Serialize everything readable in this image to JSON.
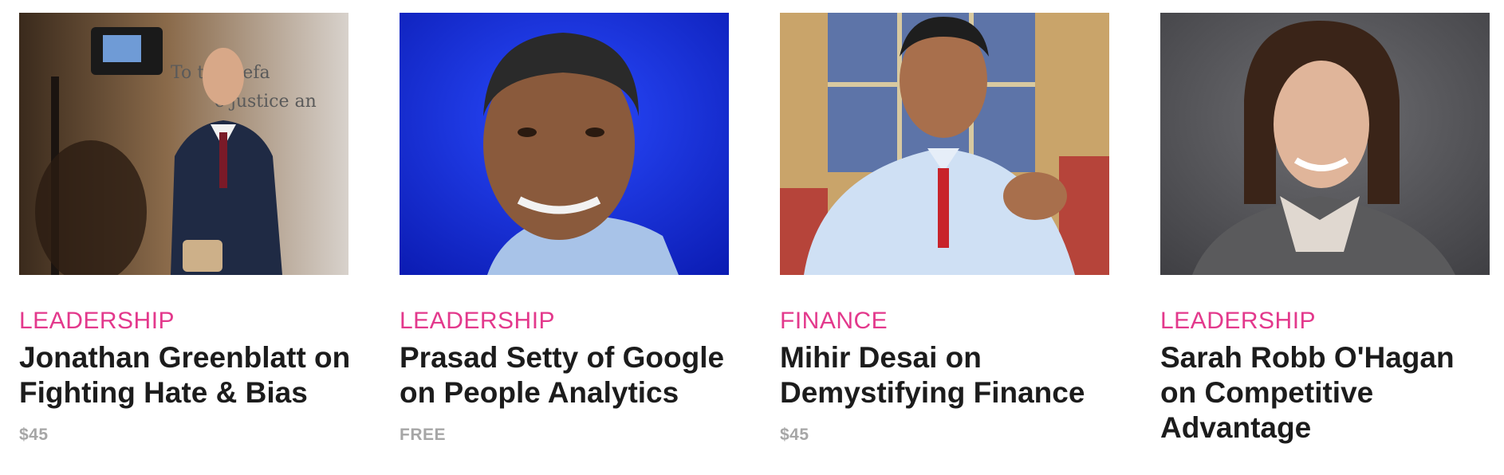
{
  "courses": [
    {
      "category": "LEADERSHIP",
      "title": "Jonathan Greenblatt on Fighting Hate & Bias",
      "price": "$45",
      "image_icon": "speaker-photo-studio"
    },
    {
      "category": "LEADERSHIP",
      "title": "Prasad Setty of Google on People Analytics",
      "price": "FREE",
      "image_icon": "speaker-photo-blue-backdrop"
    },
    {
      "category": "FINANCE",
      "title": "Mihir Desai on Demystifying Finance",
      "price": "$45",
      "image_icon": "speaker-photo-window"
    },
    {
      "category": "LEADERSHIP",
      "title": "Sarah Robb O'Hagan on Competitive Advantage",
      "price": "",
      "image_icon": "speaker-photo-gray-backdrop"
    }
  ],
  "colors": {
    "category": "#e3398c",
    "title": "#1c1c1c",
    "price": "#a6a6a6"
  }
}
